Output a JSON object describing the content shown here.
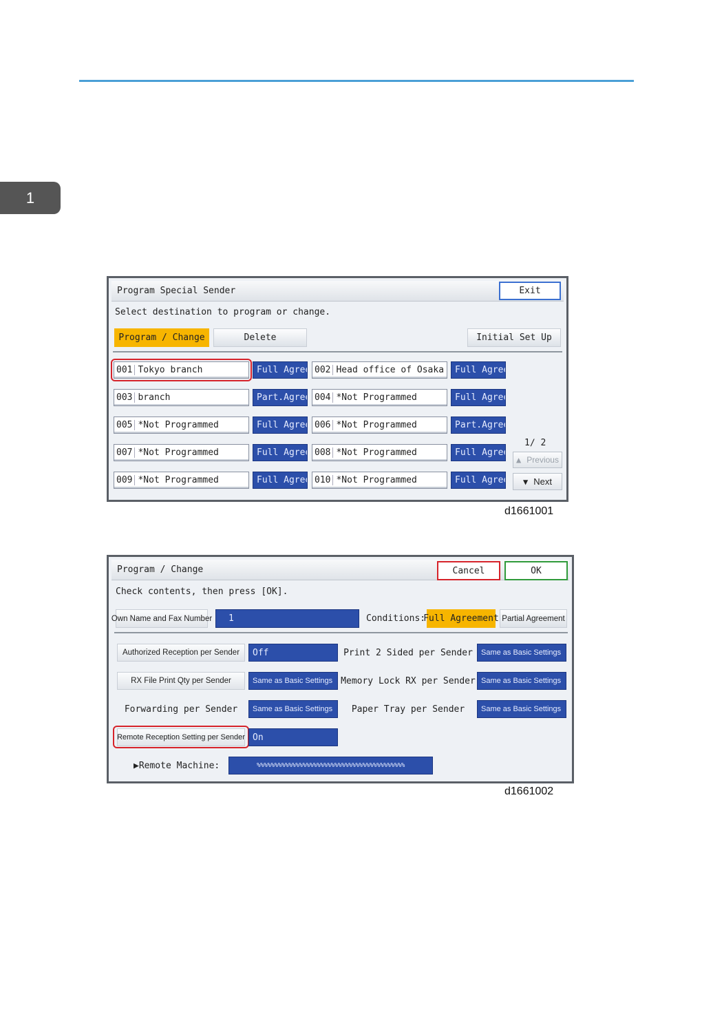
{
  "page": {
    "chapter_number": "1",
    "colors": {
      "rule": "#4a9fd6",
      "chapter_tab": "#555555",
      "selected_yellow": "#f7b500",
      "value_blue": "#2c4faa",
      "highlight_red": "#d6232a",
      "ok_green": "#2f9a3a"
    }
  },
  "screen1": {
    "title": "Program Special Sender",
    "exit_label": "Exit",
    "message": "Select destination to program or change.",
    "tabs": {
      "program_change": "Program / Change",
      "delete": "Delete",
      "initial_setup": "Initial Set Up"
    },
    "entries": [
      {
        "num": "001",
        "name": "Tokyo branch",
        "status": "Full Agree",
        "highlighted": true
      },
      {
        "num": "002",
        "name": "Head office of Osaka",
        "status": "Full Agree"
      },
      {
        "num": "003",
        "name": "branch",
        "status": "Part.Agree"
      },
      {
        "num": "004",
        "name": "*Not Programmed",
        "status": "Full Agree"
      },
      {
        "num": "005",
        "name": "*Not Programmed",
        "status": "Full Agree"
      },
      {
        "num": "006",
        "name": "*Not Programmed",
        "status": "Part.Agree"
      },
      {
        "num": "007",
        "name": "*Not Programmed",
        "status": "Full Agree"
      },
      {
        "num": "008",
        "name": "*Not Programmed",
        "status": "Full Agree"
      },
      {
        "num": "009",
        "name": "*Not Programmed",
        "status": "Full Agree"
      },
      {
        "num": "010",
        "name": "*Not Programmed",
        "status": "Full Agree"
      }
    ],
    "page_indicator": "1∕ 2",
    "previous_label": "Previous",
    "next_label": "Next",
    "caption": "d1661001",
    "icons": {
      "previous": "triangle-up-icon",
      "next": "triangle-down-icon"
    }
  },
  "screen2": {
    "title": "Program / Change",
    "cancel_label": "Cancel",
    "ok_label": "OK",
    "message": "Check contents, then press [OK].",
    "own_name_label": "Own Name and Fax Number",
    "own_name_value": "1",
    "conditions_label": "Conditions:",
    "condition_full": "Full Agreement",
    "condition_partial": "Partial Agreement",
    "settings": {
      "authorized_reception": {
        "label": "Authorized Reception per Sender",
        "value": "Off"
      },
      "print_2_sided": {
        "label": "Print 2 Sided per Sender",
        "value": "Same as Basic Settings"
      },
      "rx_file_print_qty": {
        "label": "RX File Print Qty per Sender",
        "value": "Same as Basic Settings"
      },
      "memory_lock_rx": {
        "label": "Memory Lock RX per Sender",
        "value": "Same as Basic Settings"
      },
      "forwarding": {
        "label": "Forwarding per Sender",
        "value": "Same as Basic Settings"
      },
      "paper_tray": {
        "label": "Paper Tray per Sender",
        "value": "Same as Basic Settings"
      },
      "remote_reception": {
        "label": "Remote Reception Setting per Sender",
        "value": "On"
      }
    },
    "remote_machine_label": "▶Remote Machine:",
    "remote_machine_value": "%%%%%%%%%%%%%%%%%%%%%%%%%%%%%%%%%%%%%%%%%%",
    "caption": "d1661002"
  }
}
